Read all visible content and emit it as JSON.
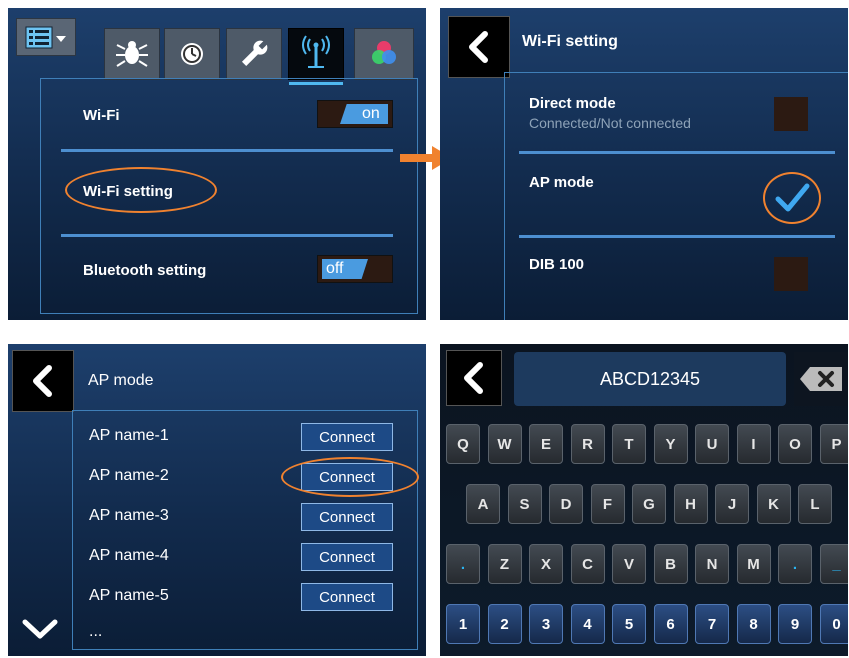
{
  "colors": {
    "accent": "#4a9be0",
    "highlight": "#f0822f",
    "panel_bg": "#16335a"
  },
  "panel1": {
    "menu_icon": "list-menu-icon",
    "tabs": [
      {
        "icon": "bug-icon"
      },
      {
        "icon": "clock-icon"
      },
      {
        "icon": "wrench-icon"
      },
      {
        "icon": "antenna-icon",
        "selected": true
      },
      {
        "icon": "color-circles-icon"
      }
    ],
    "wifi_label": "Wi-Fi",
    "wifi_toggle": "on",
    "wifi_setting_label": "Wi-Fi setting",
    "bluetooth_label": "Bluetooth setting",
    "bluetooth_toggle": "off"
  },
  "panel2": {
    "title": "Wi-Fi setting",
    "direct_mode_label": "Direct mode",
    "direct_mode_sub": "Connected/Not connected",
    "ap_mode_label": "AP mode",
    "dib_label": "DIB 100"
  },
  "panel3": {
    "title": "AP mode",
    "ap_list": [
      "AP name-1",
      "AP name-2",
      "AP name-3",
      "AP name-4",
      "AP name-5"
    ],
    "connect_label": "Connect",
    "more": "..."
  },
  "panel4": {
    "input_value": "ABCD12345",
    "row1": [
      "Q",
      "W",
      "E",
      "R",
      "T",
      "Y",
      "U",
      "I",
      "O",
      "P"
    ],
    "row2": [
      "A",
      "S",
      "D",
      "F",
      "G",
      "H",
      "J",
      "K",
      "L"
    ],
    "row3": [
      ".",
      "Z",
      "X",
      "C",
      "V",
      "B",
      "N",
      "M",
      ".",
      "_"
    ],
    "row4": [
      "1",
      "2",
      "3",
      "4",
      "5",
      "6",
      "7",
      "8",
      "9",
      "0"
    ]
  }
}
